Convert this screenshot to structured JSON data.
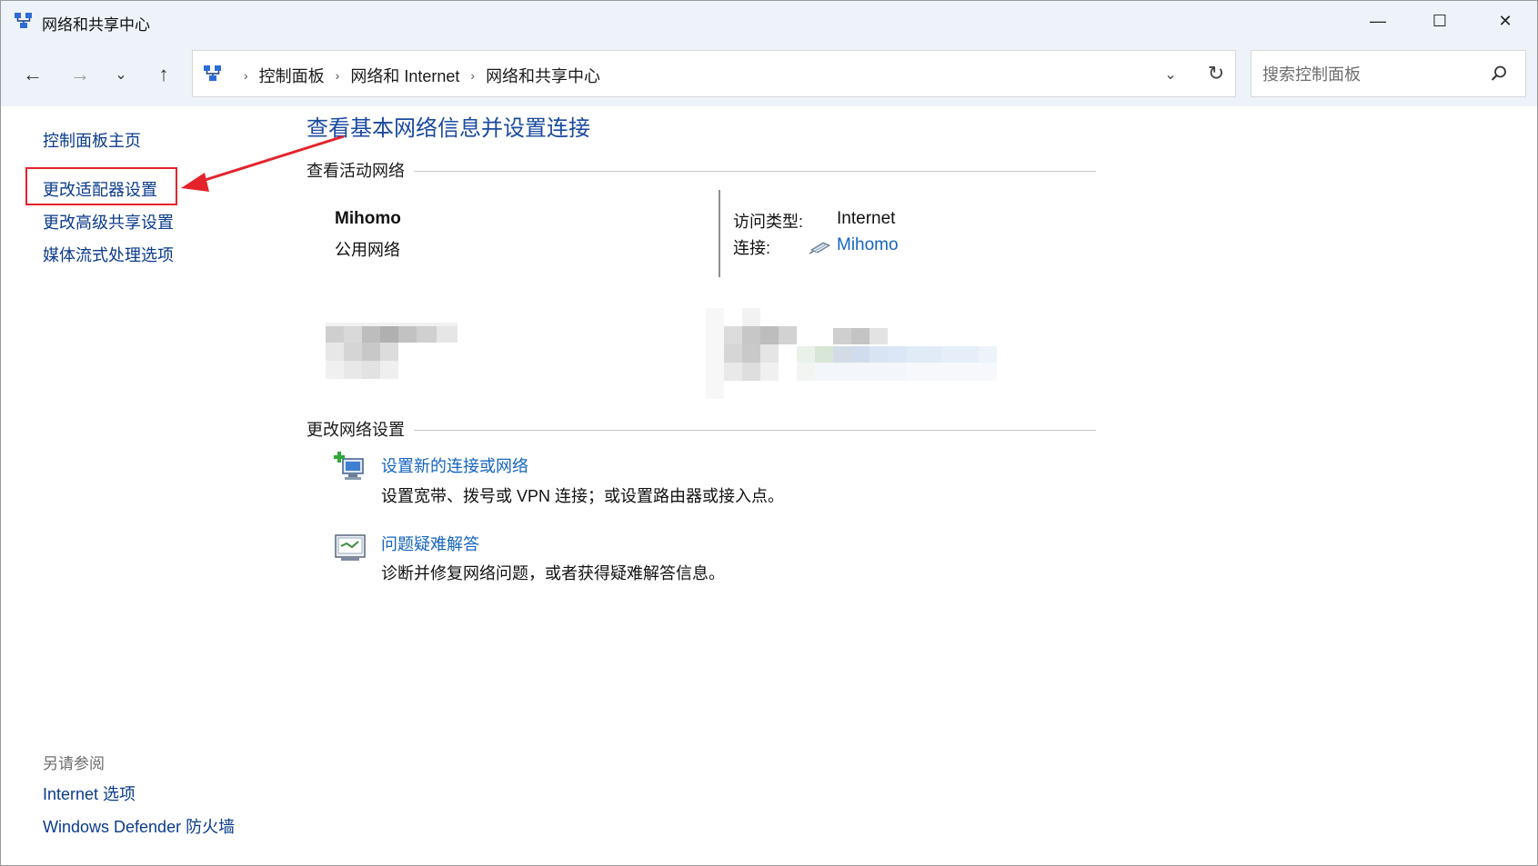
{
  "window": {
    "title": "网络和共享中心",
    "min_glyph": "—",
    "max_glyph": "☐",
    "close_glyph": "✕"
  },
  "nav": {
    "back_glyph": "←",
    "forward_glyph": "→",
    "recent_glyph": "⌄",
    "up_glyph": "↑",
    "breadcrumb": [
      "控制面板",
      "网络和 Internet",
      "网络和共享中心"
    ],
    "separator": "›",
    "dropdown_glyph": "⌄",
    "refresh_glyph": "↻",
    "search_placeholder": "搜索控制面板"
  },
  "sidebar": {
    "home": "控制面板主页",
    "adapter": "更改适配器设置",
    "advanced_sharing": "更改高级共享设置",
    "media": "媒体流式处理选项",
    "see_also_label": "另请参阅",
    "internet_options": "Internet 选项",
    "firewall": "Windows Defender 防火墙"
  },
  "main": {
    "title": "查看基本网络信息并设置连接",
    "active_section": "查看活动网络",
    "network_name": "Mihomo",
    "network_category": "公用网络",
    "access_type_label": "访问类型:",
    "access_type_value": "Internet",
    "connection_label": "连接:",
    "connection_value": "Mihomo",
    "change_section": "更改网络设置",
    "tasks": [
      {
        "title": "设置新的连接或网络",
        "desc": "设置宽带、拨号或 VPN 连接；或设置路由器或接入点。"
      },
      {
        "title": "问题疑难解答",
        "desc": "诊断并修复网络问题，或者获得疑难解答信息。"
      }
    ]
  },
  "annotation": {
    "highlight_color": "#e5232b"
  },
  "icons": {
    "app": "network-icon",
    "connection": "ethernet-icon",
    "task_new_connection": "new-connection-icon",
    "task_troubleshoot": "troubleshoot-icon",
    "search": "search-icon"
  }
}
